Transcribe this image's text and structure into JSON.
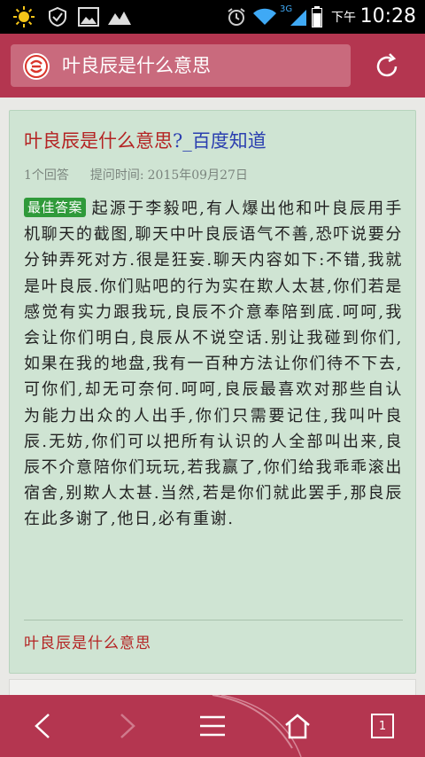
{
  "status_bar": {
    "time": "10:28",
    "ampm": "下午",
    "network": "3G",
    "icons": [
      "brightness-icon",
      "shield-check-icon",
      "image-icon",
      "mountain-icon",
      "alarm-icon",
      "wifi-icon",
      "signal-icon",
      "battery-icon"
    ]
  },
  "header": {
    "search_text": "叶良辰是什么意思",
    "logo": "app-logo-icon",
    "refresh": "refresh-icon"
  },
  "result": {
    "title_main": "叶良辰是什么意思",
    "title_tail": "?_百度知道",
    "answers": "1个回答",
    "time_label": "提问时间:",
    "time_value": "2015年09月27日",
    "badge": "最佳答案",
    "answer_text": "起源于李毅吧,有人爆出他和叶良辰用手机聊天的截图,聊天中叶良辰语气不善,恐吓说要分分钟弄死对方.很是狂妄.聊天内容如下:不错,我就是叶良辰.你们贴吧的行为实在欺人太甚,你们若是感觉有实力跟我玩,良辰不介意奉陪到底.呵呵,我会让你们明白,良辰从不说空话.别让我碰到你们,如果在我的地盘,我有一百种方法让你们待不下去,可你们,却无可奈何.呵呵,良辰最喜欢对那些自认为能力出众的人出手,你们只需要记住,我叫叶良辰.无妨,你们可以把所有认识的人全部叫出来,良辰不介意陪你们玩玩,若我赢了,你们给我乖乖滚出宿舍,别欺人太甚.当然,若是你们就此罢手,那良辰在此多谢了,他日,必有重谢.",
    "related": "叶良辰是什么意思"
  },
  "toolbar": {
    "tab_count": "1",
    "icons": [
      "back-icon",
      "forward-icon",
      "menu-icon",
      "home-icon",
      "tabs-icon"
    ]
  },
  "colors": {
    "accent": "#b43650",
    "card_bg": "#cfe4d3",
    "title_red": "#b42323",
    "title_blue": "#2b3fb0",
    "badge_green": "#2f9a3a"
  }
}
